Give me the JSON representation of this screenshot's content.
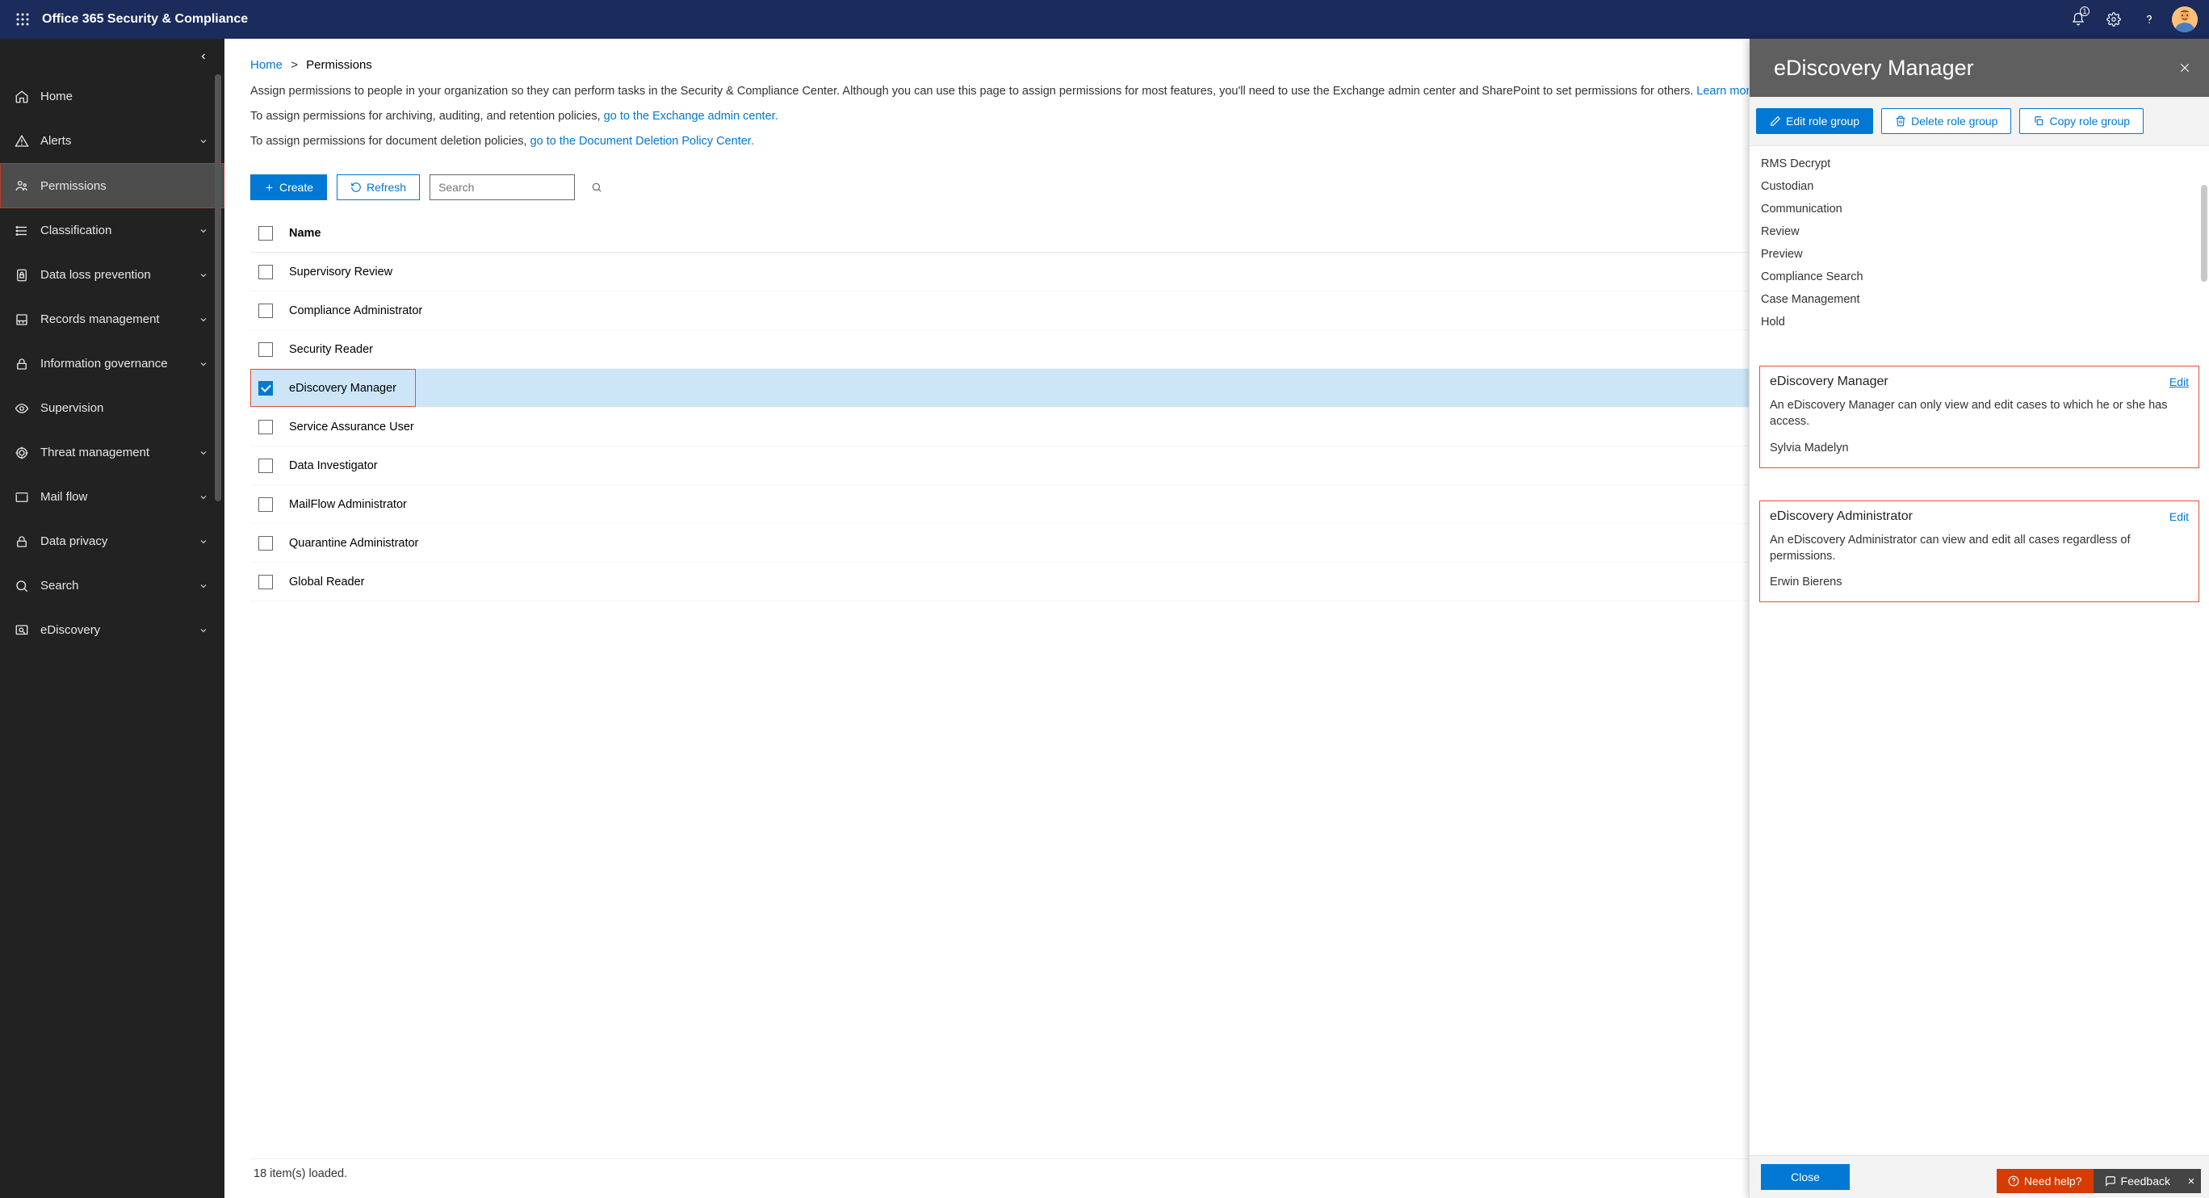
{
  "topbar": {
    "title": "Office 365 Security & Compliance",
    "notification_count": "1"
  },
  "sidebar": {
    "items": [
      {
        "label": "Home",
        "icon": "home",
        "selected": false,
        "expandable": false
      },
      {
        "label": "Alerts",
        "icon": "alert",
        "selected": false,
        "expandable": true
      },
      {
        "label": "Permissions",
        "icon": "permissions",
        "selected": true,
        "expandable": false
      },
      {
        "label": "Classification",
        "icon": "classification",
        "selected": false,
        "expandable": true
      },
      {
        "label": "Data loss prevention",
        "icon": "dlp",
        "selected": false,
        "expandable": true
      },
      {
        "label": "Records management",
        "icon": "records",
        "selected": false,
        "expandable": true
      },
      {
        "label": "Information governance",
        "icon": "lock",
        "selected": false,
        "expandable": true
      },
      {
        "label": "Supervision",
        "icon": "eye",
        "selected": false,
        "expandable": false
      },
      {
        "label": "Threat management",
        "icon": "threat",
        "selected": false,
        "expandable": true
      },
      {
        "label": "Mail flow",
        "icon": "mail",
        "selected": false,
        "expandable": true
      },
      {
        "label": "Data privacy",
        "icon": "lock",
        "selected": false,
        "expandable": true
      },
      {
        "label": "Search",
        "icon": "search",
        "selected": false,
        "expandable": true
      },
      {
        "label": "eDiscovery",
        "icon": "ediscovery",
        "selected": false,
        "expandable": true
      }
    ]
  },
  "breadcrumb": {
    "home": "Home",
    "current": "Permissions"
  },
  "content": {
    "desc1_pre": "Assign permissions to people in your organization so they can perform tasks in the Security & Compliance Center. Although you can use this page to assign permissions for most features, you'll need to use the Exchange admin center and SharePoint to set permissions for others. ",
    "desc1_link": "Learn more",
    "desc2_pre": "To assign permissions for archiving, auditing, and retention policies, ",
    "desc2_link": "go to the Exchange admin center.",
    "desc3_pre": "To assign permissions for document deletion policies, ",
    "desc3_link": "go to the Document Deletion Policy Center.",
    "toolbar": {
      "create": "Create",
      "refresh": "Refresh",
      "search_placeholder": "Search"
    },
    "column_name": "Name",
    "rows": [
      {
        "label": "Supervisory Review",
        "selected": false
      },
      {
        "label": "Compliance Administrator",
        "selected": false
      },
      {
        "label": "Security Reader",
        "selected": false
      },
      {
        "label": "eDiscovery Manager",
        "selected": true
      },
      {
        "label": "Service Assurance User",
        "selected": false
      },
      {
        "label": "Data Investigator",
        "selected": false
      },
      {
        "label": "MailFlow Administrator",
        "selected": false
      },
      {
        "label": "Quarantine Administrator",
        "selected": false
      },
      {
        "label": "Global Reader",
        "selected": false
      }
    ],
    "status": "18 item(s) loaded."
  },
  "flyout": {
    "title": "eDiscovery Manager",
    "actions": {
      "edit": "Edit role group",
      "delete": "Delete role group",
      "copy": "Copy role group"
    },
    "assigned_roles": [
      "RMS Decrypt",
      "Custodian",
      "Communication",
      "Review",
      "Preview",
      "Compliance Search",
      "Case Management",
      "Hold"
    ],
    "manager_block": {
      "title": "eDiscovery Manager",
      "edit": "Edit",
      "desc": "An eDiscovery Manager can only view and edit cases to which he or she has access.",
      "member": "Sylvia Madelyn"
    },
    "admin_block": {
      "title": "eDiscovery Administrator",
      "edit": "Edit",
      "desc": "An eDiscovery Administrator can view and edit all cases regardless of permissions.",
      "member": "Erwin Bierens"
    },
    "close": "Close"
  },
  "helpbar": {
    "need": "Need help?",
    "feedback": "Feedback"
  }
}
